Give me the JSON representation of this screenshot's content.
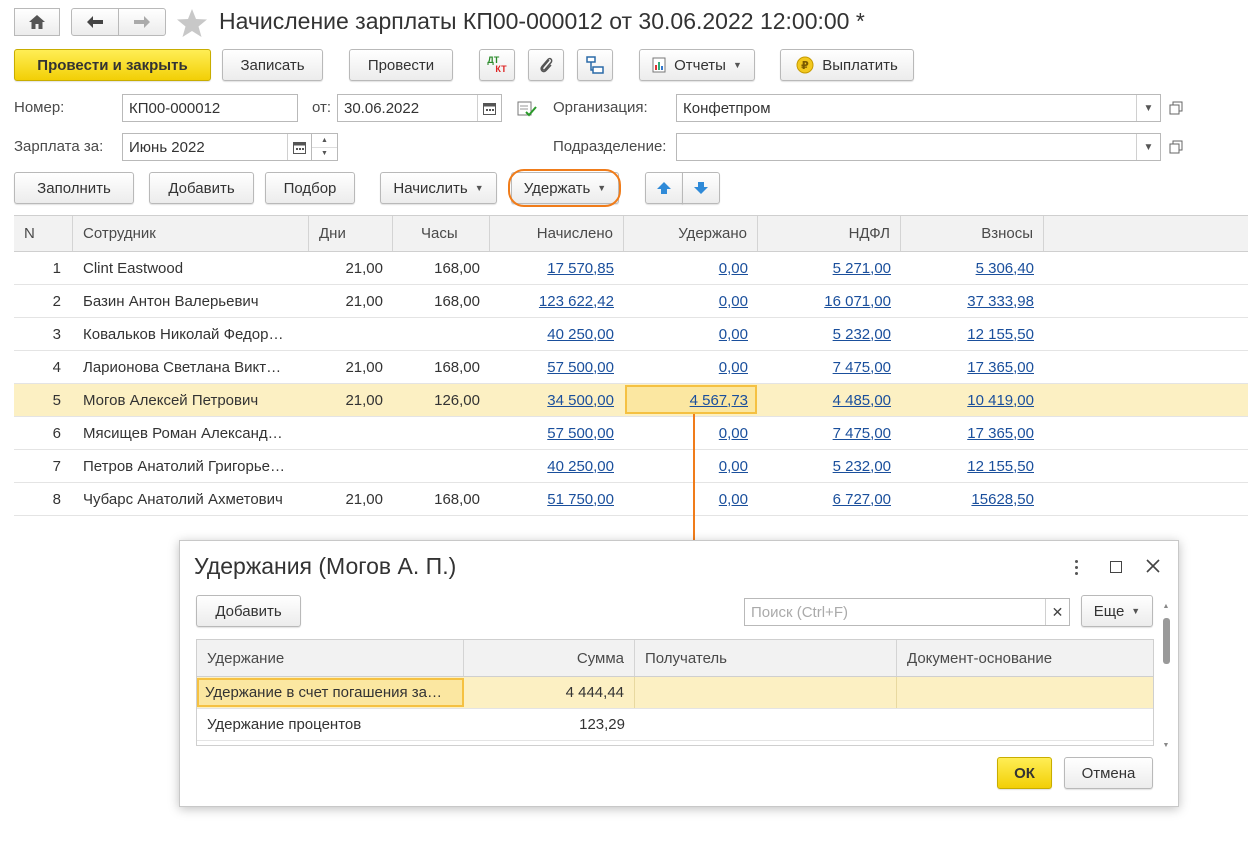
{
  "window": {
    "title": "Начисление зарплаты КП00-000012 от 30.06.2022 12:00:00 *"
  },
  "toolbar": {
    "post_close": "Провести и закрыть",
    "save": "Записать",
    "post": "Провести",
    "dtkt_top": "ДТ",
    "dtkt_bottom": "КТ",
    "reports": "Отчеты",
    "pay": "Выплатить"
  },
  "form": {
    "number_label": "Номер:",
    "number_value": "КП00-000012",
    "date_label": "от:",
    "date_value": "30.06.2022",
    "org_label": "Организация:",
    "org_value": "Конфетпром",
    "salary_label": "Зарплата за:",
    "salary_value": "Июнь 2022",
    "dept_label": "Подразделение:",
    "dept_value": ""
  },
  "table_toolbar": {
    "fill": "Заполнить",
    "add": "Добавить",
    "select": "Подбор",
    "accrue": "Начислить",
    "withhold": "Удержать"
  },
  "table": {
    "columns": [
      "N",
      "Сотрудник",
      "Дни",
      "Часы",
      "Начислено",
      "Удержано",
      "НДФЛ",
      "Взносы"
    ],
    "rows": [
      {
        "n": "1",
        "employee": "Clint Eastwood",
        "days": "21,00",
        "hours": "168,00",
        "accrued": "17 570,85",
        "withheld": "0,00",
        "ndfl": "5 271,00",
        "contrib": "5 306,40"
      },
      {
        "n": "2",
        "employee": "Базин Антон Валерьевич",
        "days": "21,00",
        "hours": "168,00",
        "accrued": "123 622,42",
        "withheld": "0,00",
        "ndfl": "16 071,00",
        "contrib": "37 333,98"
      },
      {
        "n": "3",
        "employee": "Ковальков Николай Федор…",
        "days": "",
        "hours": "",
        "accrued": "40 250,00",
        "withheld": "0,00",
        "ndfl": "5 232,00",
        "contrib": "12 155,50"
      },
      {
        "n": "4",
        "employee": "Ларионова Светлана Викт…",
        "days": "21,00",
        "hours": "168,00",
        "accrued": "57 500,00",
        "withheld": "0,00",
        "ndfl": "7 475,00",
        "contrib": "17 365,00"
      },
      {
        "n": "5",
        "employee": "Могов Алексей Петрович",
        "days": "21,00",
        "hours": "126,00",
        "accrued": "34 500,00",
        "withheld": "4 567,73",
        "ndfl": "4 485,00",
        "contrib": "10 419,00"
      },
      {
        "n": "6",
        "employee": "Мясищев Роман Александ…",
        "days": "",
        "hours": "",
        "accrued": "57 500,00",
        "withheld": "0,00",
        "ndfl": "7 475,00",
        "contrib": "17 365,00"
      },
      {
        "n": "7",
        "employee": "Петров Анатолий Григорье…",
        "days": "",
        "hours": "",
        "accrued": "40 250,00",
        "withheld": "0,00",
        "ndfl": "5 232,00",
        "contrib": "12 155,50"
      },
      {
        "n": "8",
        "employee": "Чубарс Анатолий Ахметович",
        "days": "21,00",
        "hours": "168,00",
        "accrued": "51 750,00",
        "withheld": "0,00",
        "ndfl": "6 727,00",
        "contrib": "15628,50"
      }
    ]
  },
  "dialog": {
    "title": "Удержания (Могов А. П.)",
    "add": "Добавить",
    "search_placeholder": "Поиск (Ctrl+F)",
    "more": "Еще",
    "columns": [
      "Удержание",
      "Сумма",
      "Получатель",
      "Документ-основание"
    ],
    "rows": [
      {
        "name": "Удержание в счет погашения за…",
        "sum": "4 444,44",
        "recipient": "",
        "doc": ""
      },
      {
        "name": "Удержание процентов",
        "sum": "123,29",
        "recipient": "",
        "doc": ""
      }
    ],
    "ok": "ОК",
    "cancel": "Отмена"
  },
  "colors": {
    "primary_yellow": "#f5d316",
    "selection": "#fcf0c3",
    "highlight_border": "#f5c142",
    "annotation_orange": "#f07c1a",
    "link": "#1a4f9c"
  }
}
